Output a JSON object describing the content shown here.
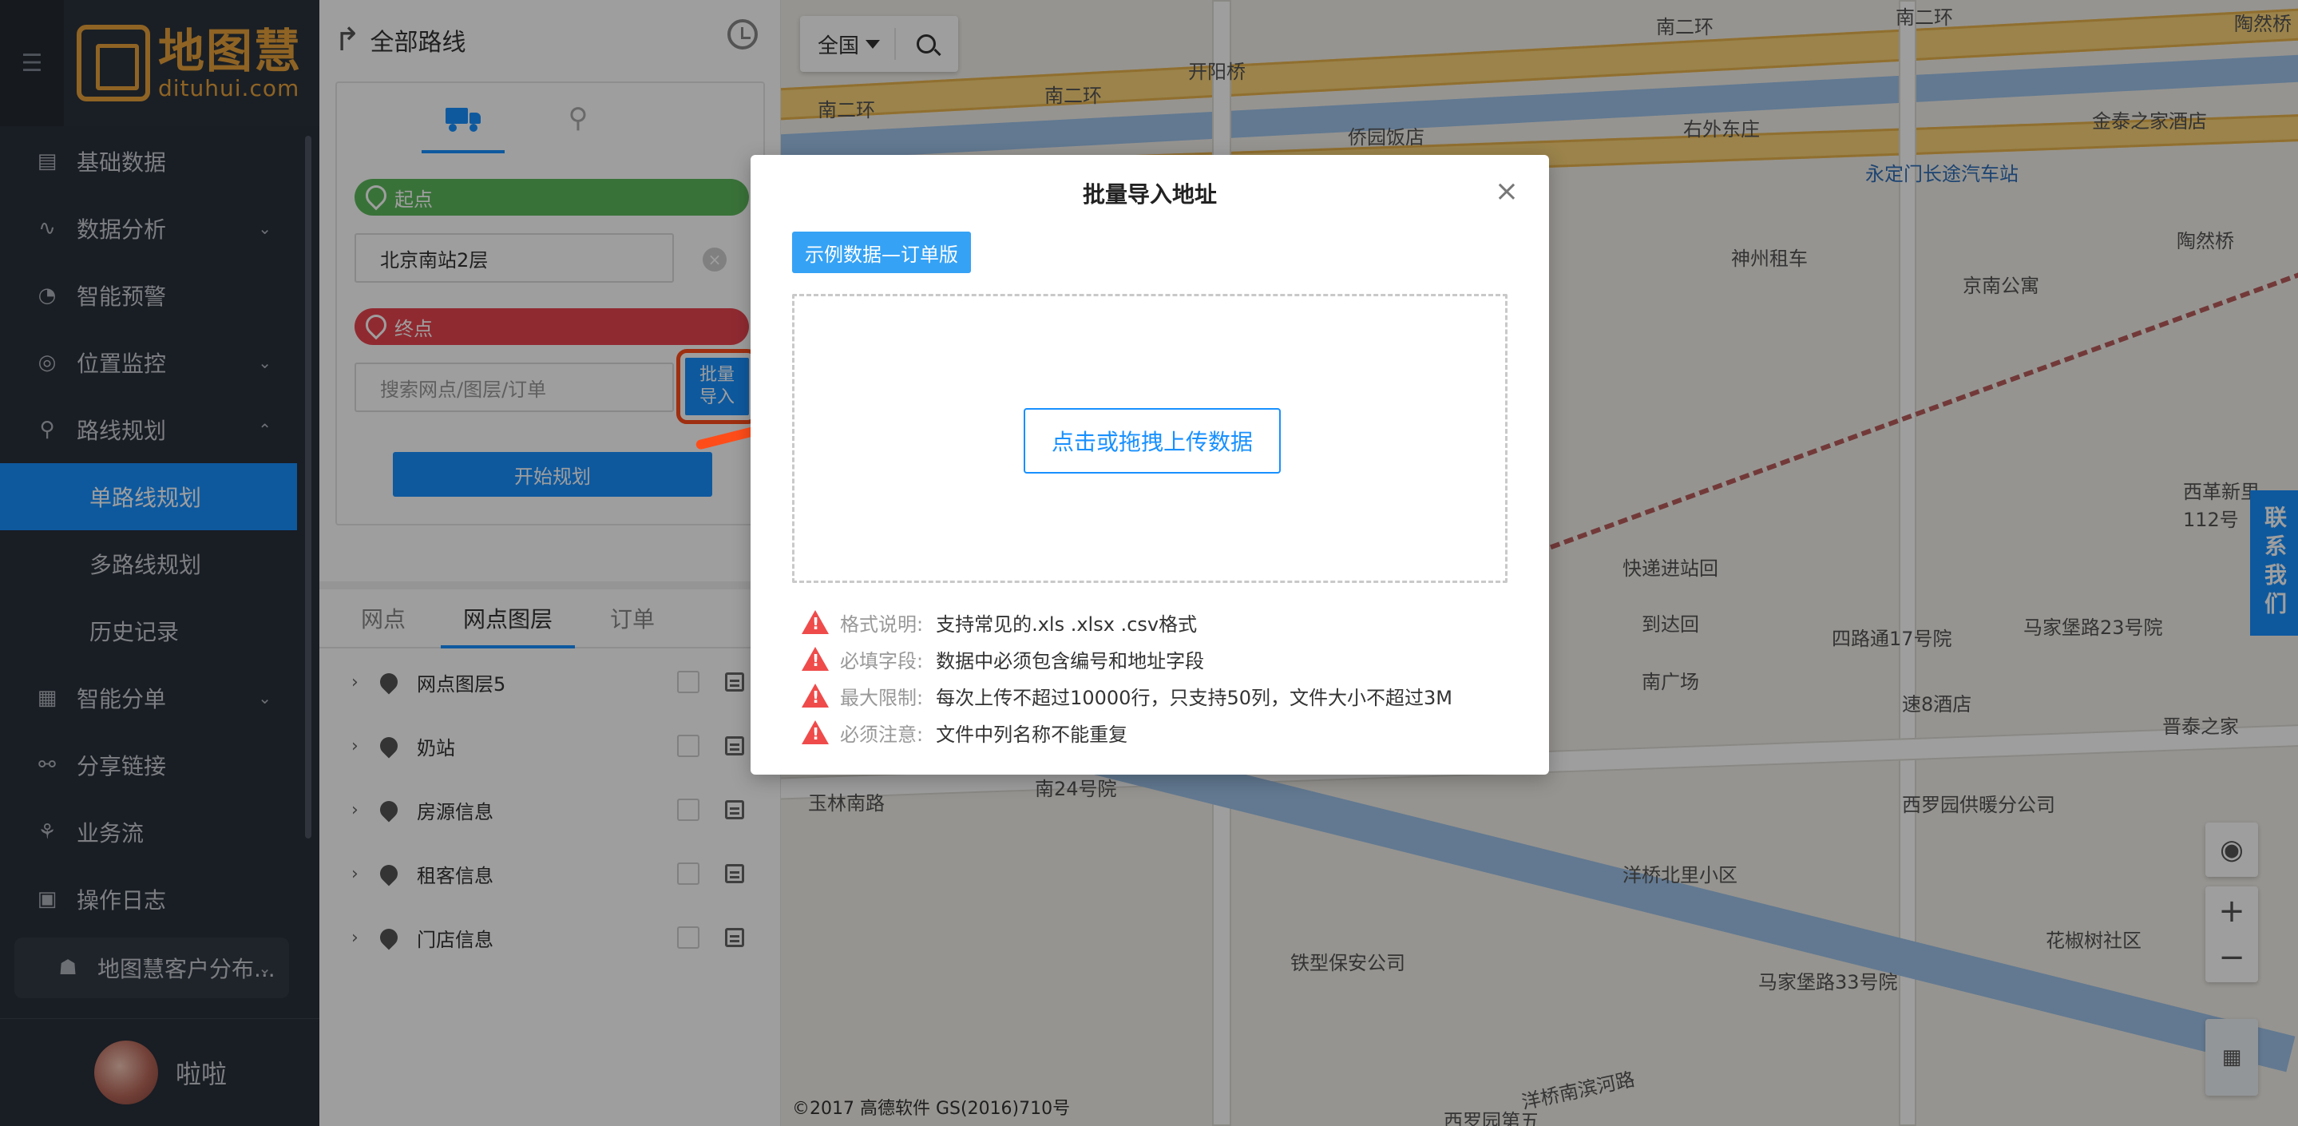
{
  "sidebar": {
    "logo_name": "地图慧",
    "logo_domain": "dituhui.com",
    "items": [
      {
        "label": "基础数据",
        "icon": "database-icon",
        "chevron": ""
      },
      {
        "label": "数据分析",
        "icon": "analysis-icon",
        "chevron": "⌄"
      },
      {
        "label": "智能预警",
        "icon": "alert-icon",
        "chevron": ""
      },
      {
        "label": "位置监控",
        "icon": "location-icon",
        "chevron": "⌄"
      },
      {
        "label": "路线规划",
        "icon": "route-icon",
        "chevron": "⌃"
      }
    ],
    "sub_items": [
      "单路线规划",
      "多路线规划",
      "历史记录"
    ],
    "items_after": [
      {
        "label": "智能分单",
        "icon": "order-icon",
        "chevron": "⌄"
      },
      {
        "label": "分享链接",
        "icon": "share-icon",
        "chevron": ""
      },
      {
        "label": "业务流",
        "icon": "workflow-icon",
        "chevron": ""
      },
      {
        "label": "操作日志",
        "icon": "log-icon",
        "chevron": ""
      }
    ],
    "group_label": "地图慧客户分布...",
    "username": "啦啦"
  },
  "panel": {
    "title": "全部路线",
    "start_label": "起点",
    "start_value": "北京南站2层",
    "end_label": "终点",
    "end_placeholder": "搜索网点/图层/订单",
    "batch_button": "批量导入",
    "start_button": "开始规划",
    "tabs": [
      "网点",
      "网点图层",
      "订单"
    ],
    "active_tab": "网点图层",
    "layers": [
      "网点图层5",
      "奶站",
      "房源信息",
      "租客信息",
      "门店信息"
    ]
  },
  "map": {
    "region": "全国",
    "copyright": "©2017 高德软件 GS(2016)710号",
    "contact": "联系我们",
    "labels": [
      {
        "text": "南二环",
        "blue": false
      },
      {
        "text": "南二环",
        "blue": false
      },
      {
        "text": "南二环",
        "blue": false
      },
      {
        "text": "南二环",
        "blue": false
      },
      {
        "text": "开阳桥",
        "blue": false
      },
      {
        "text": "侨园饭店",
        "blue": false
      },
      {
        "text": "右外东庄",
        "blue": false
      },
      {
        "text": "陶然桥",
        "blue": false
      },
      {
        "text": "金泰之家酒店",
        "blue": false
      },
      {
        "text": "永定门长途汽车站",
        "blue": true
      },
      {
        "text": "神州租车",
        "blue": false
      },
      {
        "text": "京南公寓",
        "blue": false
      },
      {
        "text": "陶然桥",
        "blue": false
      },
      {
        "text": "快递进站回",
        "blue": false
      },
      {
        "text": "到达回",
        "blue": false
      },
      {
        "text": "四路通17号院",
        "blue": false
      },
      {
        "text": "马家堡路23号院",
        "blue": false
      },
      {
        "text": "南广场",
        "blue": false
      },
      {
        "text": "速8酒店",
        "blue": false
      },
      {
        "text": "西罗园供暖分公司",
        "blue": false
      },
      {
        "text": "洋桥北里小区",
        "blue": false
      },
      {
        "text": "花椒树社区",
        "blue": false
      },
      {
        "text": "马家堡路33号院",
        "blue": false
      },
      {
        "text": "铁型保安公司",
        "blue": false
      },
      {
        "text": "西罗园第五",
        "blue": false
      },
      {
        "text": "西革新里112号",
        "blue": false
      },
      {
        "text": "晋泰之家",
        "blue": false
      },
      {
        "text": "玉林南路",
        "blue": false
      },
      {
        "text": "南24号院",
        "blue": false
      },
      {
        "text": "洋桥南滨河路",
        "blue": false
      }
    ]
  },
  "modal": {
    "title": "批量导入地址",
    "sample_button": "示例数据—订单版",
    "upload_button": "点击或拖拽上传数据",
    "notes": [
      {
        "label": "格式说明:",
        "value": "支持常见的.xls .xlsx .csv格式"
      },
      {
        "label": "必填字段:",
        "value": "数据中必须包含编号和地址字段"
      },
      {
        "label": "最大限制:",
        "value": "每次上传不超过10000行，只支持50列，文件大小不超过3M"
      },
      {
        "label": "必须注意:",
        "value": "文件中列名称不能重复"
      }
    ]
  }
}
